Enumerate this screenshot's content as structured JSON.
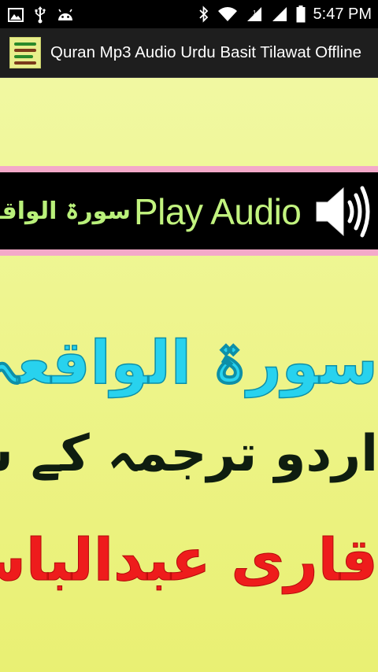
{
  "status_bar": {
    "time": "5:47 PM",
    "left_icons": [
      "image-notification-icon",
      "usb-icon",
      "android-debug-icon"
    ],
    "right_icons": [
      "bluetooth-icon",
      "wifi-icon",
      "signal-icon-1",
      "signal-icon-2",
      "battery-icon"
    ]
  },
  "action_bar": {
    "title": "Quran Mp3 Audio Urdu Basit Tilawat Offline"
  },
  "banner": {
    "surah_label": "سورۃ الواقعہ",
    "play_label": "Play  Audio"
  },
  "content": {
    "surah_name": "سورۃ الواقعہ",
    "translation_line": "اردو ترجمہ کے ساتھ",
    "qari_name": "قاری عبدالباسط"
  },
  "colors": {
    "status_bar": "#000000",
    "action_bar": "#1e1e1e",
    "page_background": "#eef58f",
    "banner_background": "#000000",
    "banner_stripe": "#f4a9c9",
    "banner_text": "#c2f37f",
    "surah_text": "#28d2ee",
    "translation_text": "#0f1d10",
    "qari_text": "#ee1c1c"
  }
}
